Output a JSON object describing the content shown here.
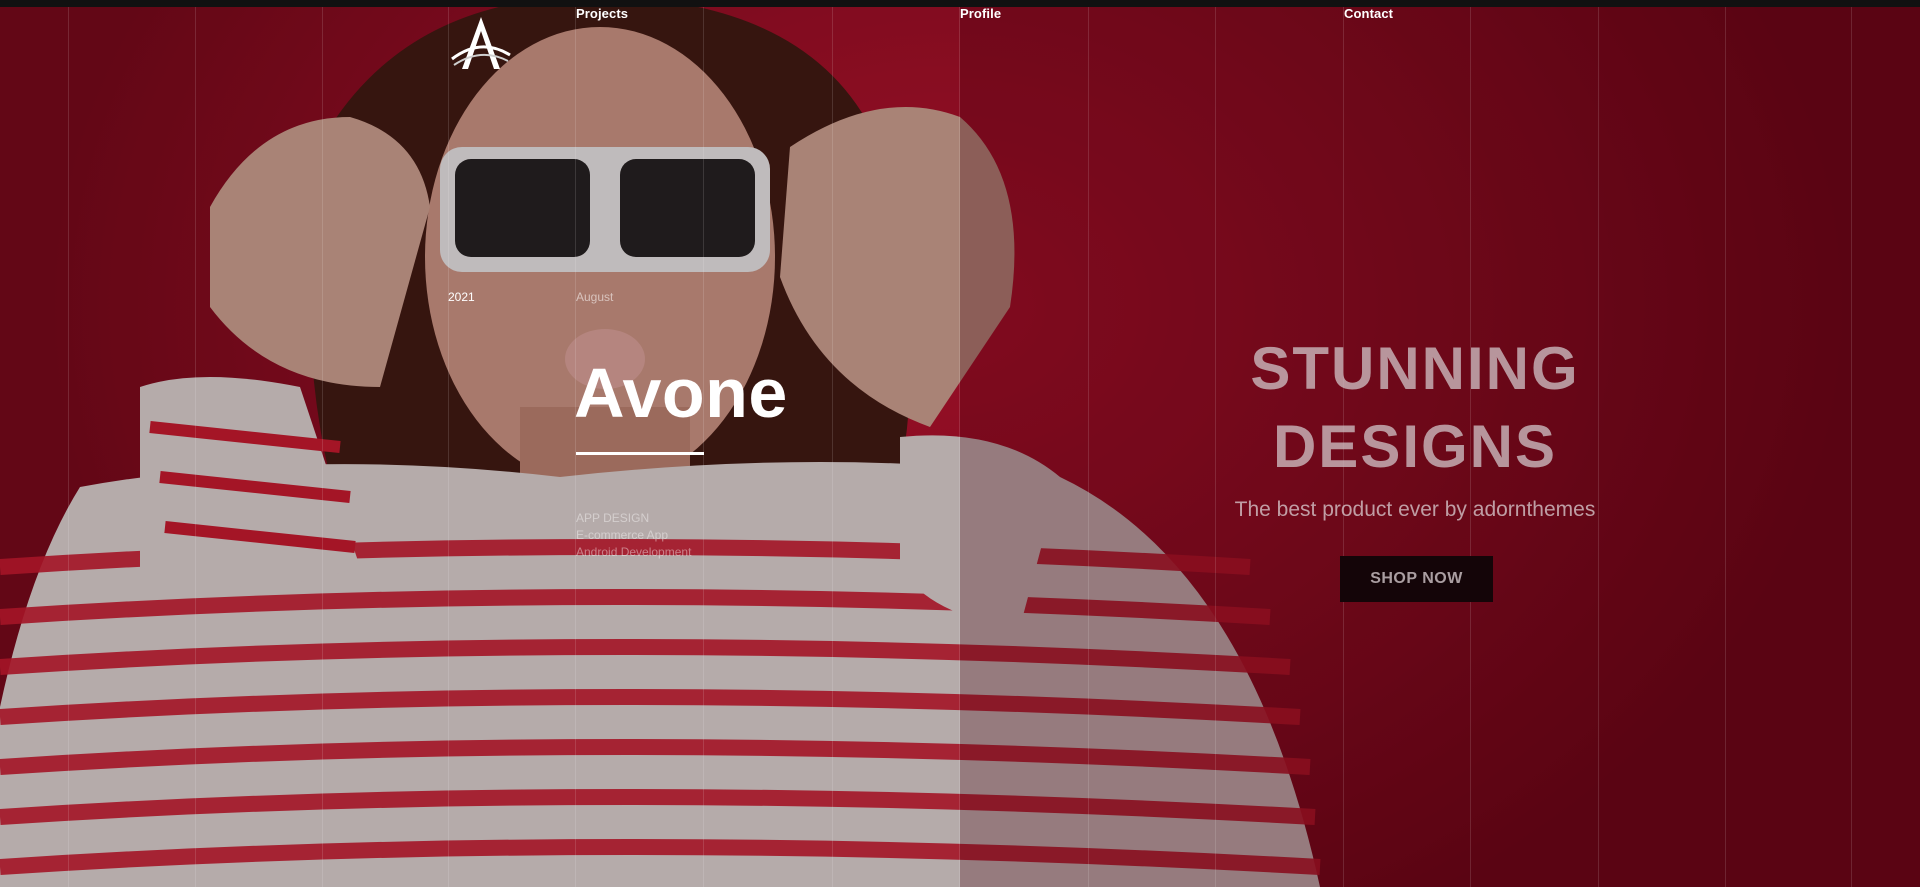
{
  "nav": {
    "links": [
      {
        "label": "Projects"
      },
      {
        "label": "Profile"
      },
      {
        "label": "Contact"
      }
    ]
  },
  "project": {
    "year": "2021",
    "month": "August",
    "title": "Avone",
    "tags": [
      "APP DESIGN",
      "E-commerce App",
      "Android Development"
    ]
  },
  "promo": {
    "heading_line1": "STUNNING",
    "heading_line2": "DESIGNS",
    "subtitle": "The best product ever by adornthemes",
    "button_label": "SHOP NOW"
  },
  "colors": {
    "background": "#9a0f26",
    "text": "#ffffff",
    "button": "#140508"
  }
}
